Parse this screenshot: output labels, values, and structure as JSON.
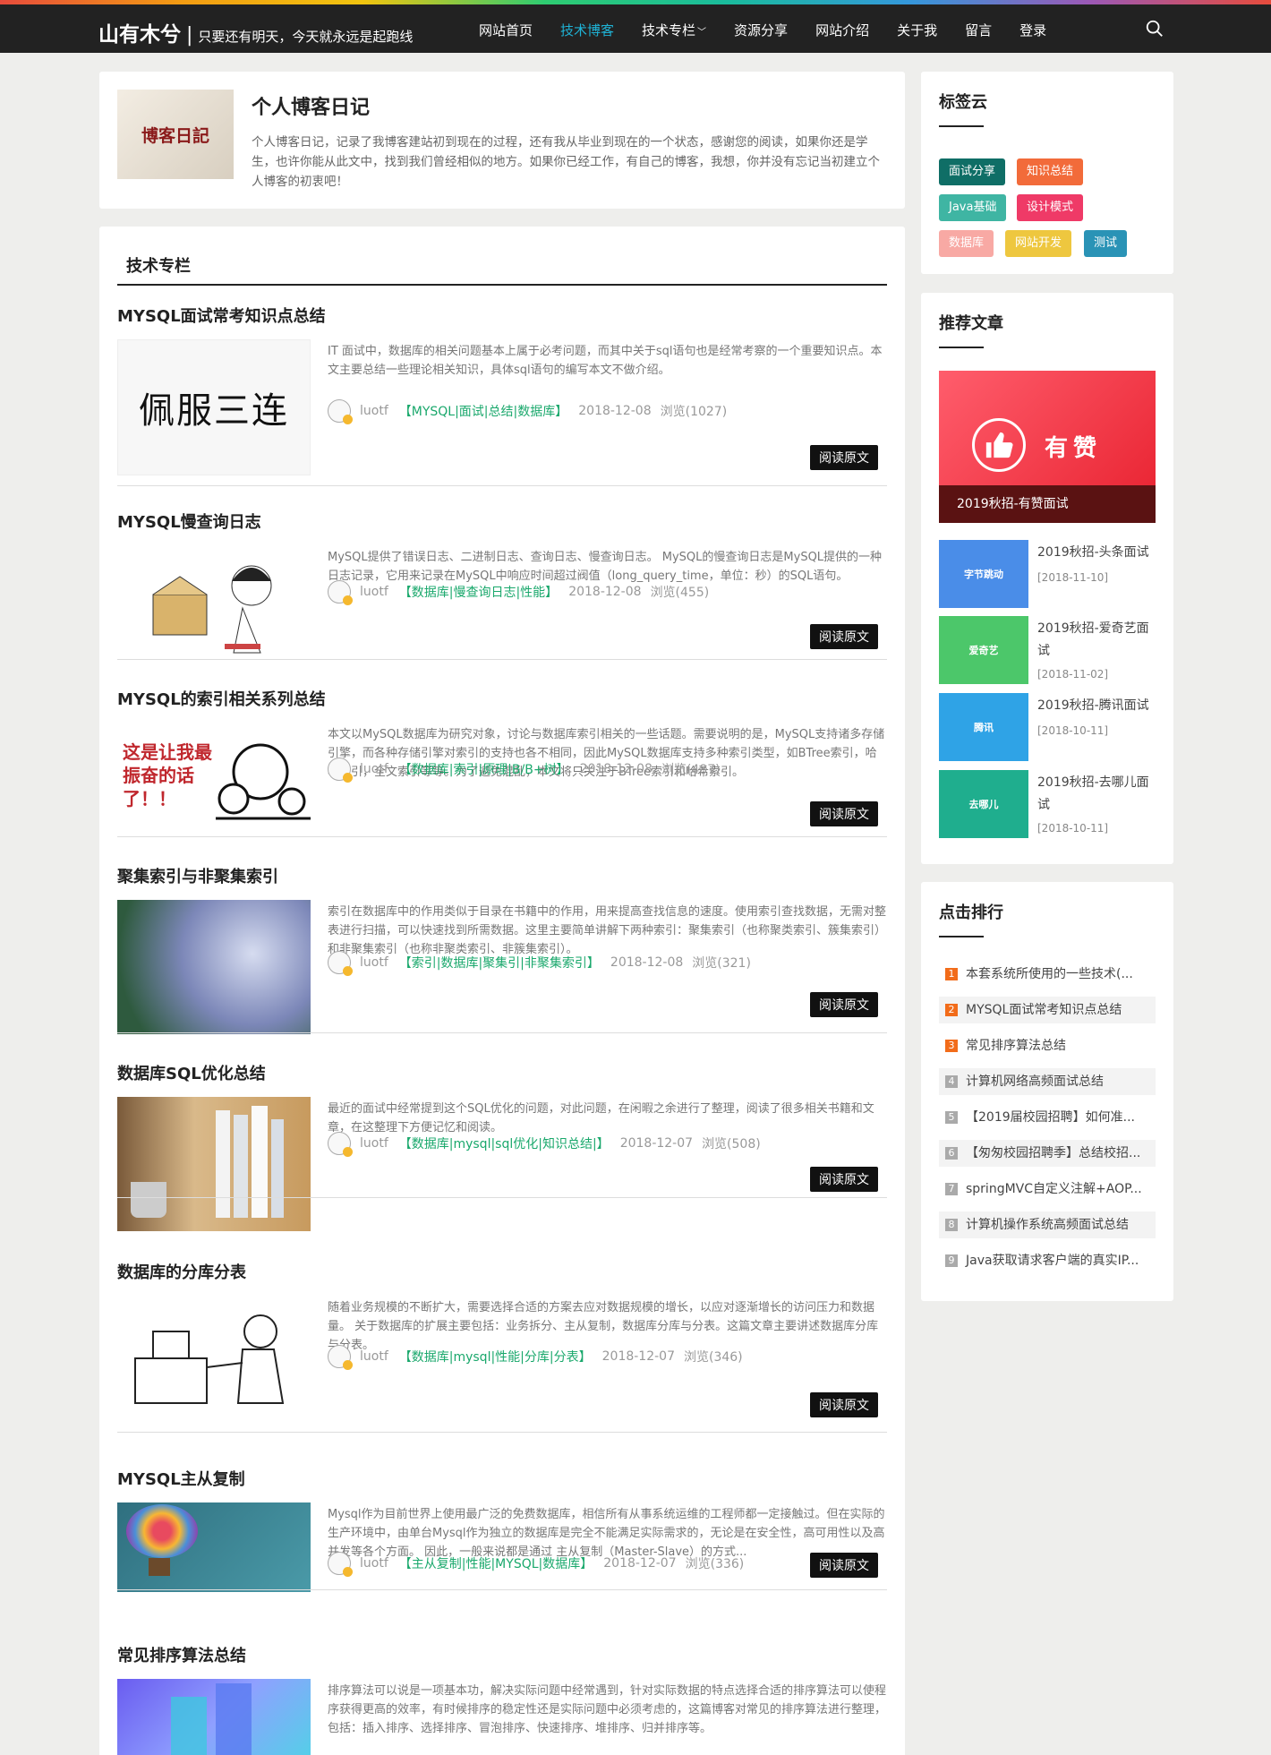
{
  "brand": {
    "name": "山有木兮",
    "separator": "|",
    "motto": "只要还有明天，今天就永远是起跑线"
  },
  "nav": {
    "items": [
      "网站首页",
      "技术博客",
      "技术专栏",
      "资源分享",
      "网站介绍",
      "关于我",
      "留言",
      "登录"
    ],
    "active": "技术博客",
    "dropdown_item": "技术专栏"
  },
  "colors": {
    "accent": "#1fb3d6",
    "tag_green": "#1aa86c"
  },
  "intro": {
    "title": "个人博客日记",
    "thumb_text": "博客日記",
    "text": "个人博客日记，记录了我博客建站初到现在的过程，还有我从毕业到现在的一个状态，感谢您的阅读，如果你还是学生，也许你能从此文中，找到我们曾经相似的地方。如果你已经工作，有自己的博客，我想，你并没有忘记当初建立个人博客的初衷吧！"
  },
  "section": {
    "title": "技术专栏"
  },
  "read_label": "阅读原文",
  "posts": [
    {
      "title": "MYSQL面试常考知识点总结",
      "img_text": "佩服三连",
      "excerpt": "IT 面试中，数据库的相关问题基本上属于必考问题，而其中关于sql语句也是经常考察的一个重要知识点。本文主要总结一些理论相关知识，具体sql语句的编写本文不做介绍。",
      "author": "luotf",
      "tags": "【MYSQL|面试|总结|数据库】",
      "date": "2018-12-08",
      "views": "浏览(1027)"
    },
    {
      "title": "MYSQL慢查询日志",
      "img_text": "",
      "excerpt": "MySQL提供了错误日志、二进制日志、查询日志、慢查询日志。 MySQL的慢查询日志是MySQL提供的一种日志记录，它用来记录在MySQL中响应时间超过阀值（long_query_time，单位：秒）的SQL语句。",
      "author": "luotf",
      "tags": "【数据库|慢查询日志|性能】",
      "date": "2018-12-08",
      "views": "浏览(455)"
    },
    {
      "title": "MYSQL的索引相关系列总结",
      "img_text": "这是让我最振奋的话了！！",
      "excerpt": "本文以MySQL数据库为研究对象，讨论与数据库索引相关的一些话题。需要说明的是，MySQL支持诸多存储引擎，而各种存储引擎对索引的支持也各不相同，因此MySQL数据库支持多种索引类型，如BTree索引，哈希索引，全文索引等等。为了避免混乱，本文将只关注于BTree索引和哈希索引。",
      "author": "luotf",
      "tags": "【数据库|索引|原理|B/B+树】",
      "date": "2018-12-08",
      "views": "浏览(487)"
    },
    {
      "title": "聚集索引与非聚集索引",
      "img_text": "",
      "excerpt": "索引在数据库中的作用类似于目录在书籍中的作用，用来提高查找信息的速度。使用索引查找数据，无需对整表进行扫描，可以快速找到所需数据。这里主要简单讲解下两种索引：聚集索引（也称聚类索引、簇集索引）和非聚集索引（也称非聚类索引、非簇集索引）。",
      "author": "luotf",
      "tags": "【索引|数据库|聚集引|非聚集索引】",
      "date": "2018-12-08",
      "views": "浏览(321)"
    },
    {
      "title": "数据库SQL优化总结",
      "img_text": "",
      "excerpt": "最近的面试中经常提到这个SQL优化的问题，对此问题，在闲暇之余进行了整理，阅读了很多相关书籍和文章，在这整理下方便记忆和阅读。",
      "author": "luotf",
      "tags": "【数据库|mysql|sql优化|知识总结|】",
      "date": "2018-12-07",
      "views": "浏览(508)"
    },
    {
      "title": "数据库的分库分表",
      "img_text": "",
      "excerpt": "随着业务规模的不断扩大，需要选择合适的方案去应对数据规模的增长，以应对逐渐增长的访问压力和数据量。 关于数据库的扩展主要包括：业务拆分、主从复制，数据库分库与分表。这篇文章主要讲述数据库分库与分表。",
      "author": "luotf",
      "tags": "【数据库|mysql|性能|分库|分表】",
      "date": "2018-12-07",
      "views": "浏览(346)"
    },
    {
      "title": "MYSQL主从复制",
      "img_text": "",
      "excerpt": "Mysql作为目前世界上使用最广泛的免费数据库，相信所有从事系统运维的工程师都一定接触过。但在实际的生产环境中，由单台Mysql作为独立的数据库是完全不能满足实际需求的，无论是在安全性，高可用性以及高并发等各个方面。 因此，一般来说都是通过 主从复制（Master-Slave）的方式...",
      "author": "luotf",
      "tags": "【主从复制|性能|MYSQL|数据库】",
      "date": "2018-12-07",
      "views": "浏览(336)"
    },
    {
      "title": "常见排序算法总结",
      "img_text": "",
      "excerpt": "排序算法可以说是一项基本功，解决实际问题中经常遇到，针对实际数据的特点选择合适的排序算法可以使程序获得更高的效率，有时候排序的稳定性还是实际问题中必须考虑的，这篇博客对常见的排序算法进行整理，包括：插入排序、选择排序、冒泡排序、快速排序、堆排序、归并排序等。",
      "author": "luotf",
      "tags": "",
      "date": "",
      "views": ""
    }
  ],
  "tagcloud": {
    "title": "标签云",
    "tags": [
      "面试分享",
      "知识总结",
      "Java基础",
      "设计模式",
      "数据库",
      "网站开发",
      "测试"
    ]
  },
  "recommend": {
    "title": "推荐文章",
    "hero_brand": "有赞",
    "hero_caption": "2019秋招-有赞面试",
    "items": [
      {
        "title": "2019秋招-头条面试",
        "date": "[2018-11-10]",
        "logo": "字节跳动"
      },
      {
        "title": "2019秋招-爱奇艺面试",
        "date": "[2018-11-02]",
        "logo": "爱奇艺"
      },
      {
        "title": "2019秋招-腾讯面试",
        "date": "[2018-10-11]",
        "logo": "腾讯"
      },
      {
        "title": "2019秋招-去哪儿面试",
        "date": "[2018-10-11]",
        "logo": "去哪儿"
      }
    ]
  },
  "ranking": {
    "title": "点击排行",
    "items": [
      "本套系统所使用的一些技术(...",
      "MYSQL面试常考知识点总结",
      "常见排序算法总结",
      "计算机网络高频面试总结",
      "【2019届校园招聘】如何准...",
      "【匆匆校园招聘季】总结校招...",
      "springMVC自定义注解+AOP...",
      "计算机操作系统高频面试总结",
      "Java获取请求客户端的真实IP..."
    ]
  }
}
